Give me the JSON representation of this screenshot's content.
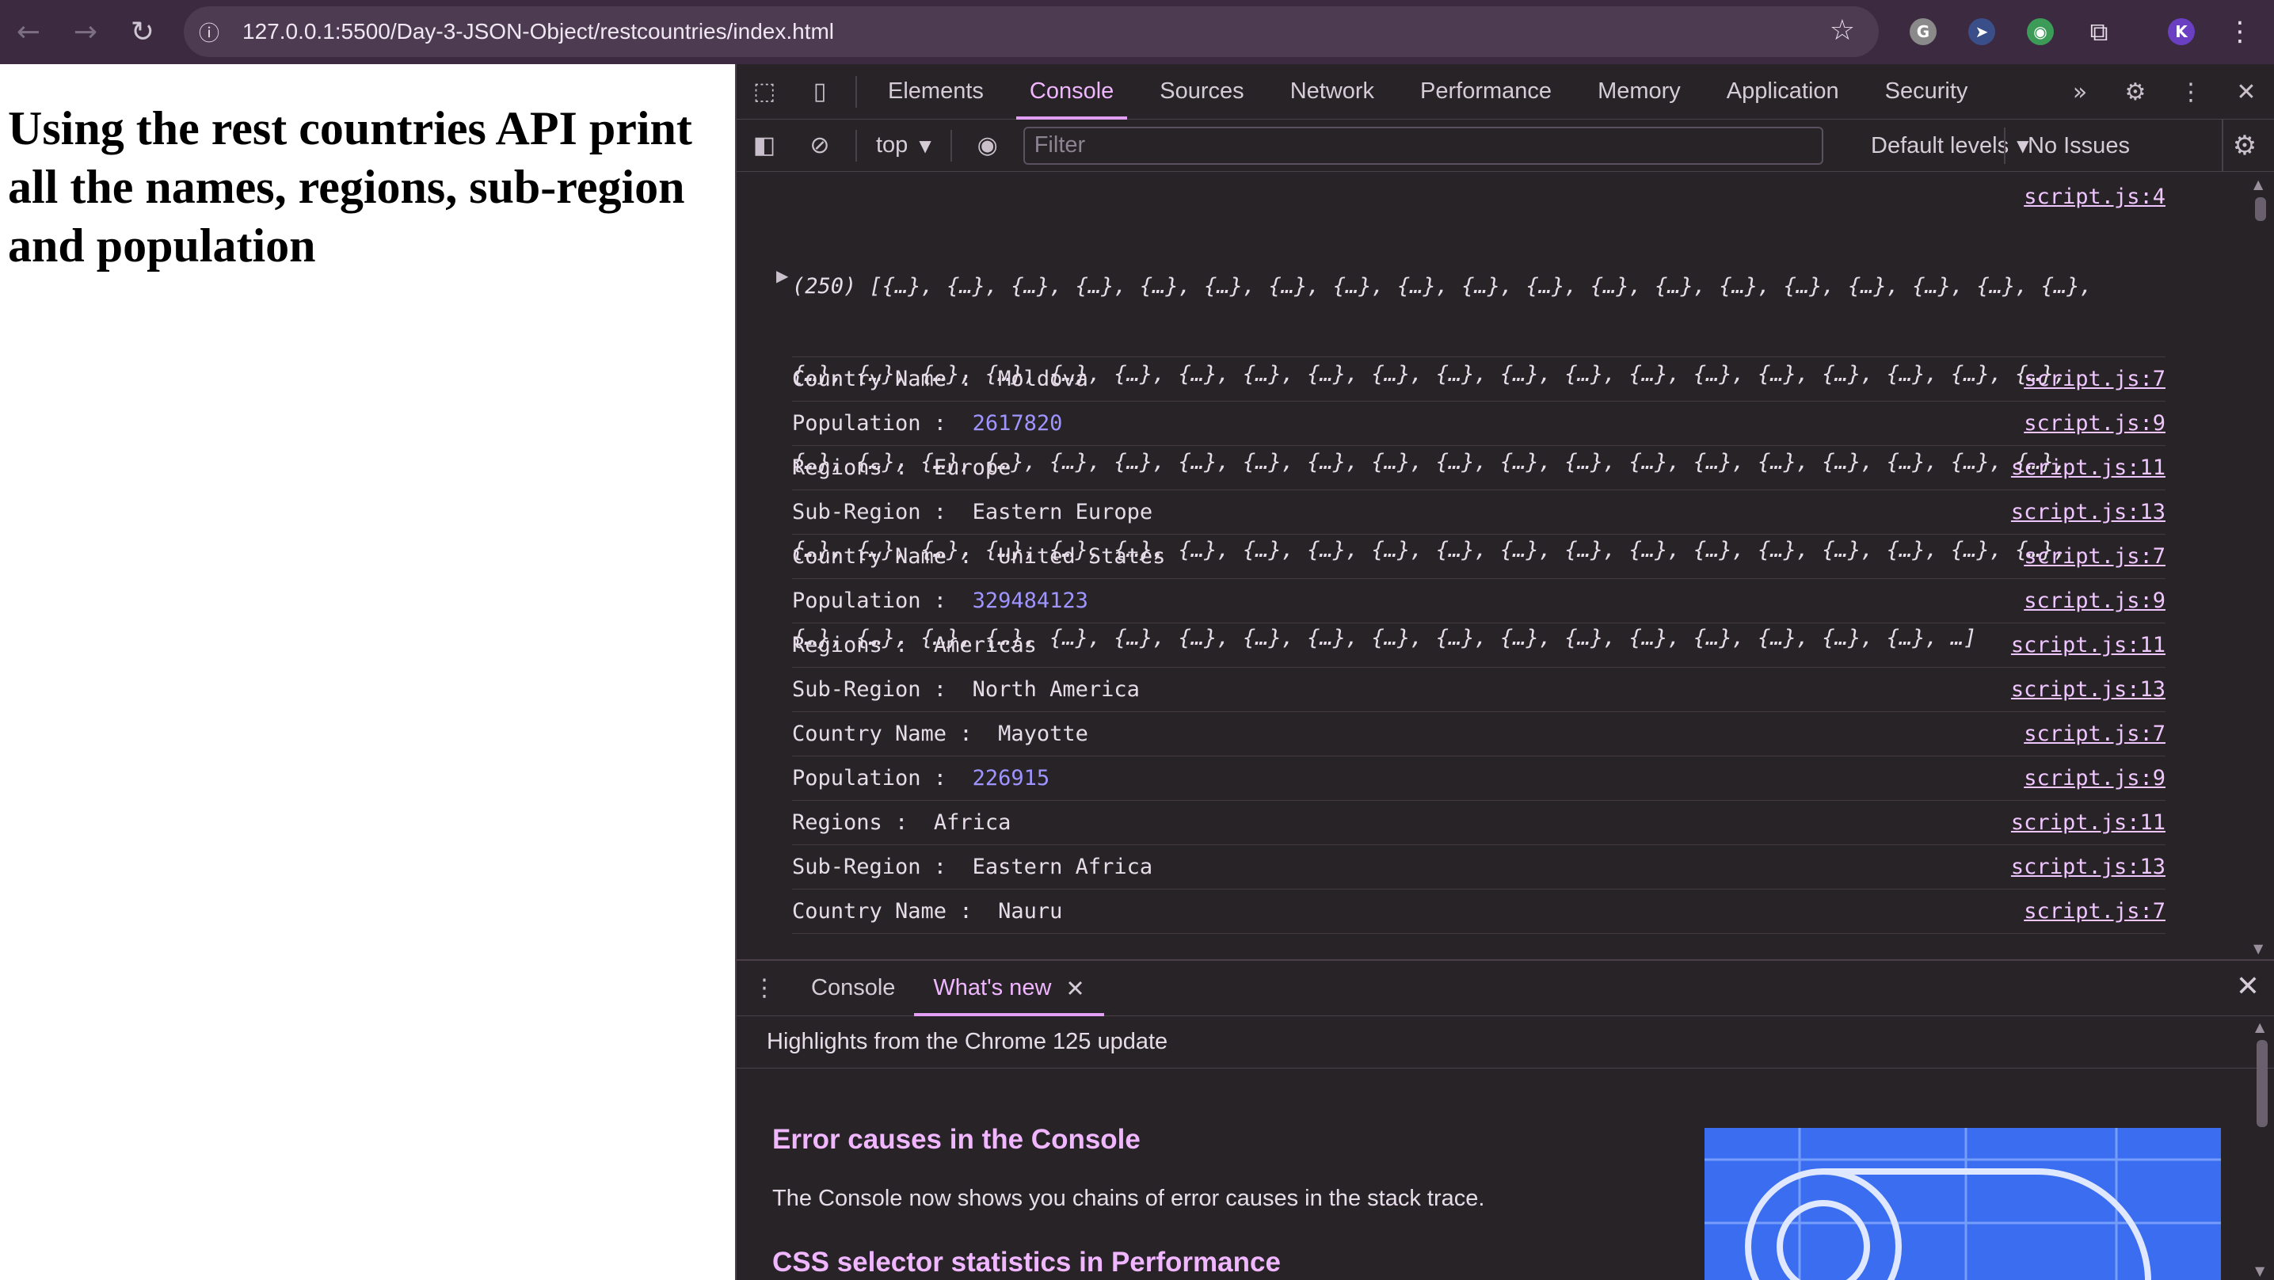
{
  "browser": {
    "url": "127.0.0.1:5500/Day-3-JSON-Object/restcountries/index.html",
    "profile_initial": "K"
  },
  "page": {
    "heading": "Using the rest countries API print all the names, regions, sub-region and population"
  },
  "devtools": {
    "tabs": [
      "Elements",
      "Console",
      "Sources",
      "Network",
      "Performance",
      "Memory",
      "Application",
      "Security"
    ],
    "active_tab": "Console",
    "toolbar": {
      "context": "top",
      "filter_placeholder": "Filter",
      "levels": "Default levels",
      "issues": "No Issues"
    },
    "console": {
      "array_source": "script.js:4",
      "array_lines": [
        "(250) [{…}, {…}, {…}, {…}, {…}, {…}, {…}, {…}, {…}, {…}, {…}, {…}, {…}, {…}, {…}, {…}, {…}, {…}, {…},",
        "{…}, {…}, {…}, {…}, {…}, {…}, {…}, {…}, {…}, {…}, {…}, {…}, {…}, {…}, {…}, {…}, {…}, {…}, {…}, {…},",
        "{…}, {…}, {…}, {…}, {…}, {…}, {…}, {…}, {…}, {…}, {…}, {…}, {…}, {…}, {…}, {…}, {…}, {…}, {…}, {…},",
        "{…}, {…}, {…}, {…}, {…}, {…}, {…}, {…}, {…}, {…}, {…}, {…}, {…}, {…}, {…}, {…}, {…}, {…}, {…}, {…},",
        "{…}, {…}, {…}, {…}, {…}, {…}, {…}, {…}, {…}, {…}, {…}, {…}, {…}, {…}, {…}, {…}, {…}, {…}, …]"
      ],
      "rows": [
        {
          "label": "Country Name :  ",
          "value": "Moldova",
          "numeric": false,
          "source": "script.js:7"
        },
        {
          "label": "Population :  ",
          "value": "2617820",
          "numeric": true,
          "source": "script.js:9"
        },
        {
          "label": "Regions :  ",
          "value": "Europe",
          "numeric": false,
          "source": "script.js:11"
        },
        {
          "label": "Sub-Region :  ",
          "value": "Eastern Europe",
          "numeric": false,
          "source": "script.js:13"
        },
        {
          "label": "Country Name :  ",
          "value": "United States",
          "numeric": false,
          "source": "script.js:7"
        },
        {
          "label": "Population :  ",
          "value": "329484123",
          "numeric": true,
          "source": "script.js:9"
        },
        {
          "label": "Regions :  ",
          "value": "Americas",
          "numeric": false,
          "source": "script.js:11"
        },
        {
          "label": "Sub-Region :  ",
          "value": "North America",
          "numeric": false,
          "source": "script.js:13"
        },
        {
          "label": "Country Name :  ",
          "value": "Mayotte",
          "numeric": false,
          "source": "script.js:7"
        },
        {
          "label": "Population :  ",
          "value": "226915",
          "numeric": true,
          "source": "script.js:9"
        },
        {
          "label": "Regions :  ",
          "value": "Africa",
          "numeric": false,
          "source": "script.js:11"
        },
        {
          "label": "Sub-Region :  ",
          "value": "Eastern Africa",
          "numeric": false,
          "source": "script.js:13"
        },
        {
          "label": "Country Name :  ",
          "value": "Nauru",
          "numeric": false,
          "source": "script.js:7"
        }
      ]
    },
    "drawer": {
      "tabs": [
        "Console",
        "What's new"
      ],
      "active_tab": "What's new",
      "header": "Highlights from the Chrome 125 update",
      "section1_title": "Error causes in the Console",
      "section1_text": "The Console now shows you chains of error causes in the stack trace.",
      "section2_title": "CSS selector statistics in Performance"
    }
  },
  "colors": {
    "chrome_bg": "#3b2a40",
    "devtools_bg": "#282327",
    "accent": "#f0b6ff",
    "number": "#9f95ff"
  }
}
